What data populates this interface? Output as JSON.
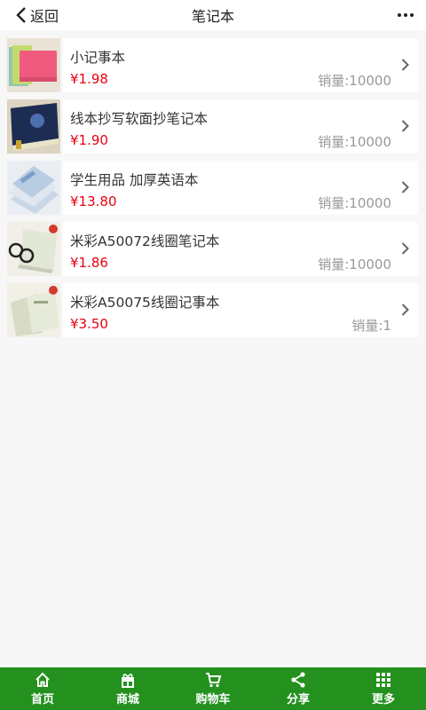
{
  "header": {
    "back_label": "返回",
    "title": "笔记本"
  },
  "products": [
    {
      "name": "小记事本",
      "price": "¥1.98",
      "sales": "销量:10000",
      "thumb": "pink-notebook"
    },
    {
      "name": "线本抄写软面抄笔记本",
      "price": "¥1.90",
      "sales": "销量:10000",
      "thumb": "dark-notebook"
    },
    {
      "name": "学生用品 加厚英语本",
      "price": "¥13.80",
      "sales": "销量:10000",
      "thumb": "english-notebook"
    },
    {
      "name": "米彩A50072线圈笔记本",
      "price": "¥1.86",
      "sales": "销量:10000",
      "thumb": "coil-notebook-glasses"
    },
    {
      "name": "米彩A50075线圈记事本",
      "price": "¥3.50",
      "sales": "销量:1",
      "thumb": "coil-notebook"
    }
  ],
  "tabbar": {
    "items": [
      {
        "label": "首页",
        "icon": "home-icon"
      },
      {
        "label": "商城",
        "icon": "gift-icon"
      },
      {
        "label": "购物车",
        "icon": "cart-icon"
      },
      {
        "label": "分享",
        "icon": "share-icon"
      },
      {
        "label": "更多",
        "icon": "grid-icon"
      }
    ]
  },
  "colors": {
    "accent": "#24911f",
    "price": "#e60012",
    "muted": "#999999",
    "background": "#f7f7f7"
  }
}
